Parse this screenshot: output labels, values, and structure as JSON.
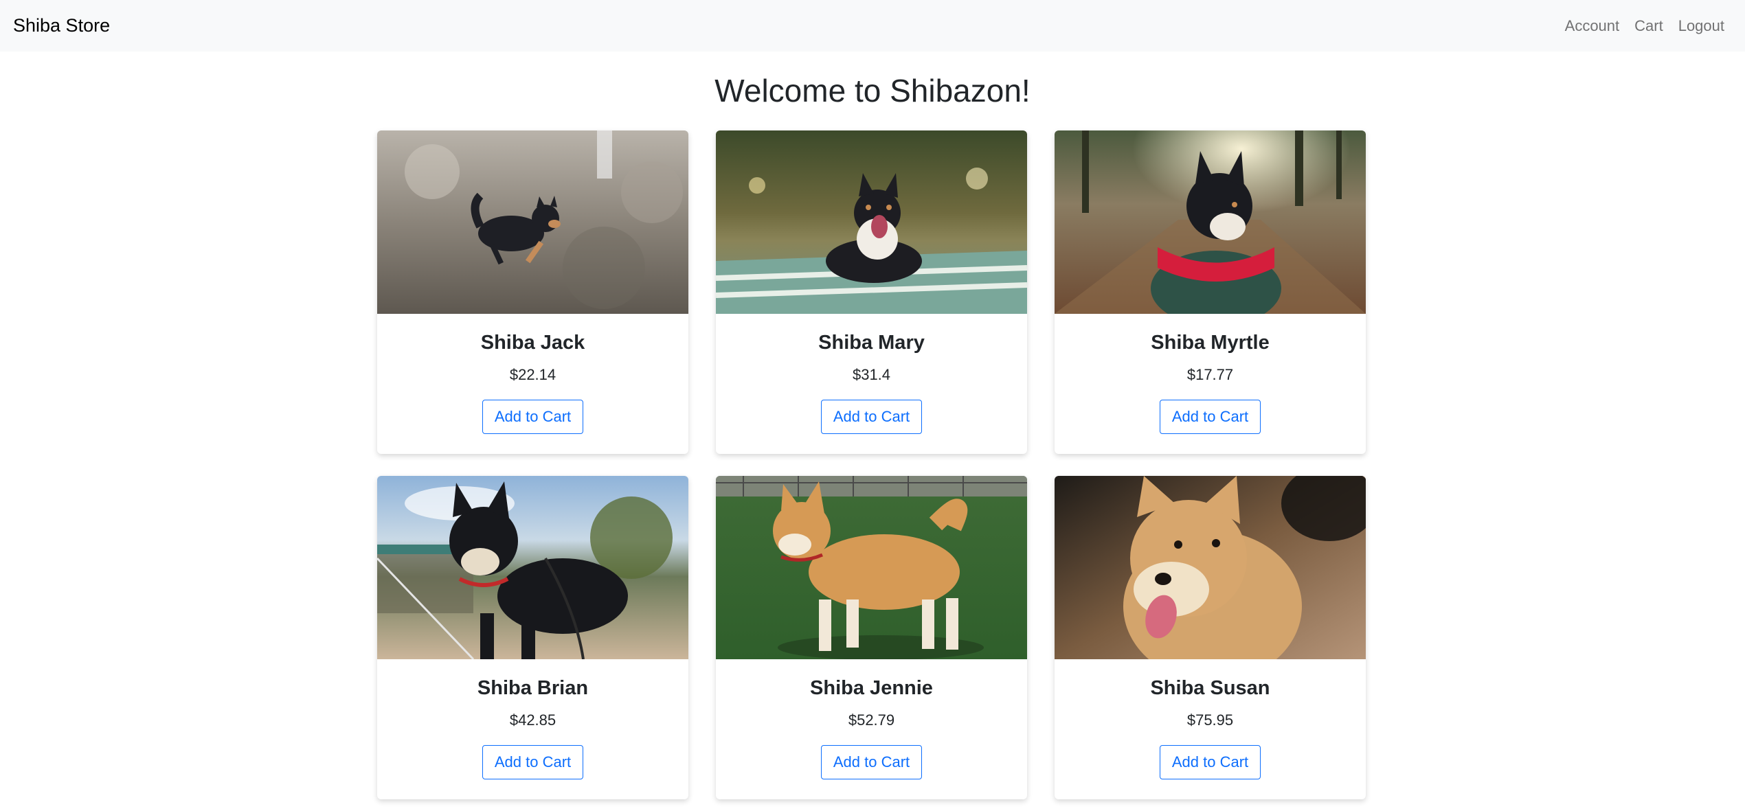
{
  "navbar": {
    "brand": "Shiba Store",
    "links": [
      {
        "label": "Account"
      },
      {
        "label": "Cart"
      },
      {
        "label": "Logout"
      }
    ]
  },
  "main": {
    "title": "Welcome to Shibazon!",
    "products": [
      {
        "name": "Shiba Jack",
        "price": "$22.14",
        "button": "Add to Cart"
      },
      {
        "name": "Shiba Mary",
        "price": "$31.4",
        "button": "Add to Cart"
      },
      {
        "name": "Shiba Myrtle",
        "price": "$17.77",
        "button": "Add to Cart"
      },
      {
        "name": "Shiba Brian",
        "price": "$42.85",
        "button": "Add to Cart"
      },
      {
        "name": "Shiba Jennie",
        "price": "$52.79",
        "button": "Add to Cart"
      },
      {
        "name": "Shiba Susan",
        "price": "$75.95",
        "button": "Add to Cart"
      }
    ]
  },
  "colors": {
    "navbar_bg": "#f8f9fa",
    "primary": "#0d6efd",
    "text": "#212529",
    "nav_link": "#737373"
  }
}
